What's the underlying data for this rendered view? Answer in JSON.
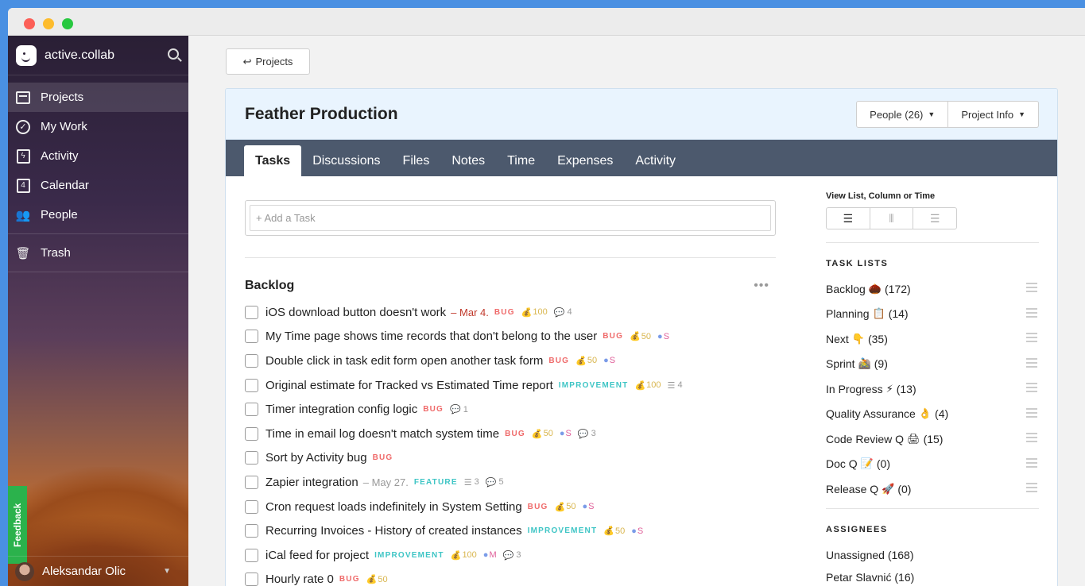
{
  "sidebar": {
    "brand": "active.collab",
    "nav": [
      {
        "label": "Projects",
        "icon": "projects-icon",
        "active": true
      },
      {
        "label": "My Work",
        "icon": "check-circle-icon"
      },
      {
        "label": "Activity",
        "icon": "activity-icon"
      },
      {
        "label": "Calendar",
        "icon": "calendar-icon",
        "day": "4"
      },
      {
        "label": "People",
        "icon": "people-icon"
      }
    ],
    "trash_label": "Trash",
    "feedback_label": "Feedback",
    "user_name": "Aleksandar Olic"
  },
  "main": {
    "back_label": "Projects",
    "project_title": "Feather Production",
    "people_button": "People (26)",
    "project_info_button": "Project Info",
    "tabs": [
      "Tasks",
      "Discussions",
      "Files",
      "Notes",
      "Time",
      "Expenses",
      "Activity"
    ],
    "add_task_placeholder": "+ Add a Task",
    "list_title": "Backlog",
    "tasks": [
      {
        "name": "iOS download button doesn't work",
        "due": "– Mar 4.",
        "label": "BUG",
        "estimate": "100",
        "comments": "4"
      },
      {
        "name": "My Time page shows time records that don't belong to the user",
        "label": "BUG",
        "estimate": "50",
        "size": "S"
      },
      {
        "name": "Double click in task edit form open another task form",
        "label": "BUG",
        "estimate": "50",
        "size": "S"
      },
      {
        "name": "Original estimate for Tracked vs Estimated Time report",
        "label": "IMPROVEMENT",
        "estimate": "100",
        "subtasks": "4"
      },
      {
        "name": "Timer integration config logic",
        "label": "BUG",
        "comments": "1"
      },
      {
        "name": "Time in email log doesn't match system time",
        "label": "BUG",
        "estimate": "50",
        "size": "S",
        "comments": "3"
      },
      {
        "name": "Sort by Activity bug",
        "label": "BUG"
      },
      {
        "name": "Zapier integration",
        "due": "– May 27.",
        "label": "FEATURE",
        "subtasks": "3",
        "comments": "5"
      },
      {
        "name": "Cron request loads indefinitely in System Setting",
        "label": "BUG",
        "estimate": "50",
        "size": "S"
      },
      {
        "name": "Recurring Invoices - History of created instances",
        "label": "IMPROVEMENT",
        "estimate": "50",
        "size": "S"
      },
      {
        "name": "iCal feed for project",
        "label": "IMPROVEMENT",
        "estimate": "100",
        "size": "M",
        "comments": "3"
      },
      {
        "name": "Hourly rate 0",
        "label": "BUG",
        "estimate": "50"
      }
    ]
  },
  "right": {
    "view_label": "View List, Column or Time",
    "task_lists_title": "TASK LISTS",
    "task_lists": [
      {
        "name": "Backlog",
        "emoji": "🌰",
        "count": "(172)"
      },
      {
        "name": "Planning",
        "emoji": "📋",
        "count": "(14)"
      },
      {
        "name": "Next",
        "emoji": "👇",
        "count": "(35)"
      },
      {
        "name": "Sprint",
        "emoji": "🚵",
        "count": "(9)"
      },
      {
        "name": "In Progress",
        "emoji": "⚡",
        "count": "(13)"
      },
      {
        "name": "Quality Assurance",
        "emoji": "👌",
        "count": "(4)"
      },
      {
        "name": "Code Review Q",
        "emoji": "🖨",
        "count": "(15)"
      },
      {
        "name": "Doc Q",
        "emoji": "📝",
        "count": "(0)"
      },
      {
        "name": "Release Q",
        "emoji": "🚀",
        "count": "(0)"
      }
    ],
    "assignees_title": "ASSIGNEES",
    "assignees": [
      "Unassigned (168)",
      "Petar Slavnić (16)"
    ]
  },
  "colors": {
    "sidebar_active": "#3d3149",
    "tabs_bg": "#4c596d",
    "bug": "#ef6a6a",
    "improvement": "#3ec5c5",
    "feedback": "#2bb24c"
  }
}
